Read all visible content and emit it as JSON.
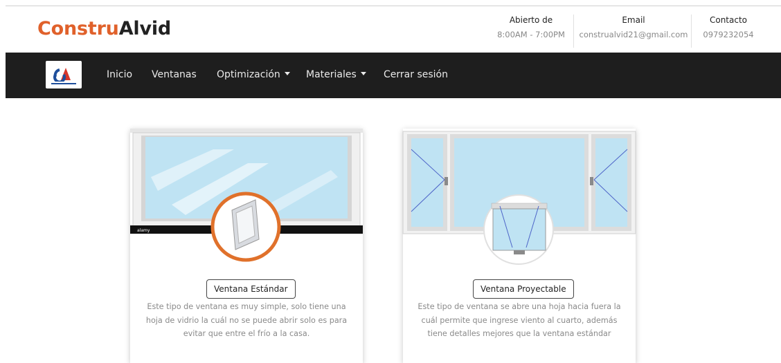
{
  "brand": {
    "part1": "Constru",
    "part2": "Alvid",
    "logo_text": "CONSTRUALVID"
  },
  "header_info": [
    {
      "title": "Abierto de",
      "value": "8:00AM - 7:00PM"
    },
    {
      "title": "Email",
      "value": "construalvid21@gmail.com"
    },
    {
      "title": "Contacto",
      "value": "0979232054"
    }
  ],
  "nav": {
    "items": [
      {
        "label": "Inicio"
      },
      {
        "label": "Ventanas"
      },
      {
        "label": "Optimización",
        "dropdown": true
      },
      {
        "label": "Materiales",
        "dropdown": true
      },
      {
        "label": "Cerrar sesión"
      }
    ]
  },
  "cards": [
    {
      "button": "Ventana Estándar",
      "description": "Este tipo de ventana es muy simple, solo tiene una hoja de vidrio la cuál no se puede abrir solo es para evitar que entre el frío a la casa.",
      "image_label": "alamy"
    },
    {
      "button": "Ventana Proyectable",
      "description": "Este tipo de ventana se abre una hoja hacia fuera la cuál permite que ingrese viento al cuarto, además tiene detalles mejores que la ventana estándar"
    }
  ],
  "colors": {
    "accent": "#e0612b",
    "navbar": "#1e1e1e",
    "glass": "#bfe3f3"
  }
}
